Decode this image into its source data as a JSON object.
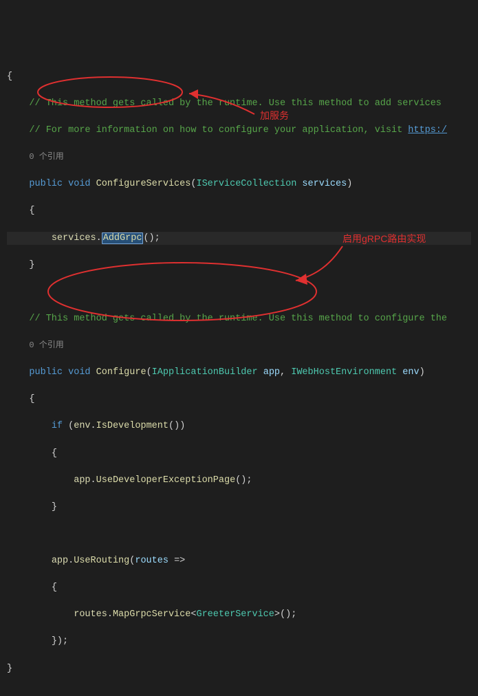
{
  "code": {
    "brace_open": "{",
    "comment1_a": "// This method gets called by the runtime. Use this method to add services",
    "comment1_b": "// For more information on how to configure your application, visit ",
    "comment1_link": "https:/",
    "refs": "0 个引用",
    "kw_public": "public",
    "kw_void": "void",
    "m_configservices": "ConfigureServices",
    "t_iservicecollection": "IServiceCollection",
    "p_services": "services",
    "brace_open2": "{",
    "svc_var": "services",
    "dot": ".",
    "m_addgrpc": "AddGrpc",
    "parens": "()",
    "semi": ";",
    "brace_close2": "}",
    "comment2": "// This method gets called by the runtime. Use this method to configure the",
    "m_configure": "Configure",
    "t_iappbuilder": "IApplicationBuilder",
    "p_app": "app",
    "comma": ", ",
    "t_iwebhostenv": "IWebHostEnvironment",
    "p_env": "env",
    "kw_if": "if",
    "env_var": "env",
    "m_isdev": "IsDevelopment",
    "app_var": "app",
    "m_usedevexc": "UseDeveloperExceptionPage",
    "m_userouting": "UseRouting",
    "lambda_p": "routes",
    "lambda_arrow": " =>",
    "routes_var": "routes",
    "m_mapgrpc": "MapGrpcService",
    "lt": "<",
    "gt": ">",
    "t_greeter": "GreeterService",
    "brace_close_outer": "}",
    "close_paren_semi": "});"
  },
  "annotations": {
    "anno1": "加服务",
    "anno2": "启用gRPC路由实现"
  }
}
